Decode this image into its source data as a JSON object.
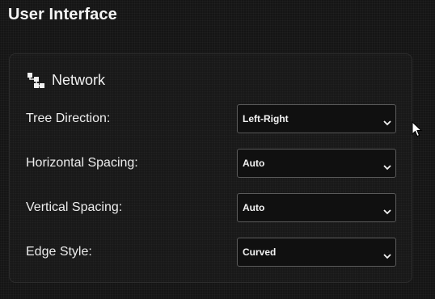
{
  "page": {
    "title": "User Interface"
  },
  "panel": {
    "icon": "network-tree-icon",
    "title": "Network",
    "fields": [
      {
        "label": "Tree Direction:",
        "value": "Left-Right"
      },
      {
        "label": "Horizontal Spacing:",
        "value": "Auto"
      },
      {
        "label": "Vertical Spacing:",
        "value": "Auto"
      },
      {
        "label": "Edge Style:",
        "value": "Curved"
      }
    ]
  },
  "colors": {
    "background": "#151515",
    "text": "#f2f2f2",
    "select_border": "#5a5a5a"
  }
}
